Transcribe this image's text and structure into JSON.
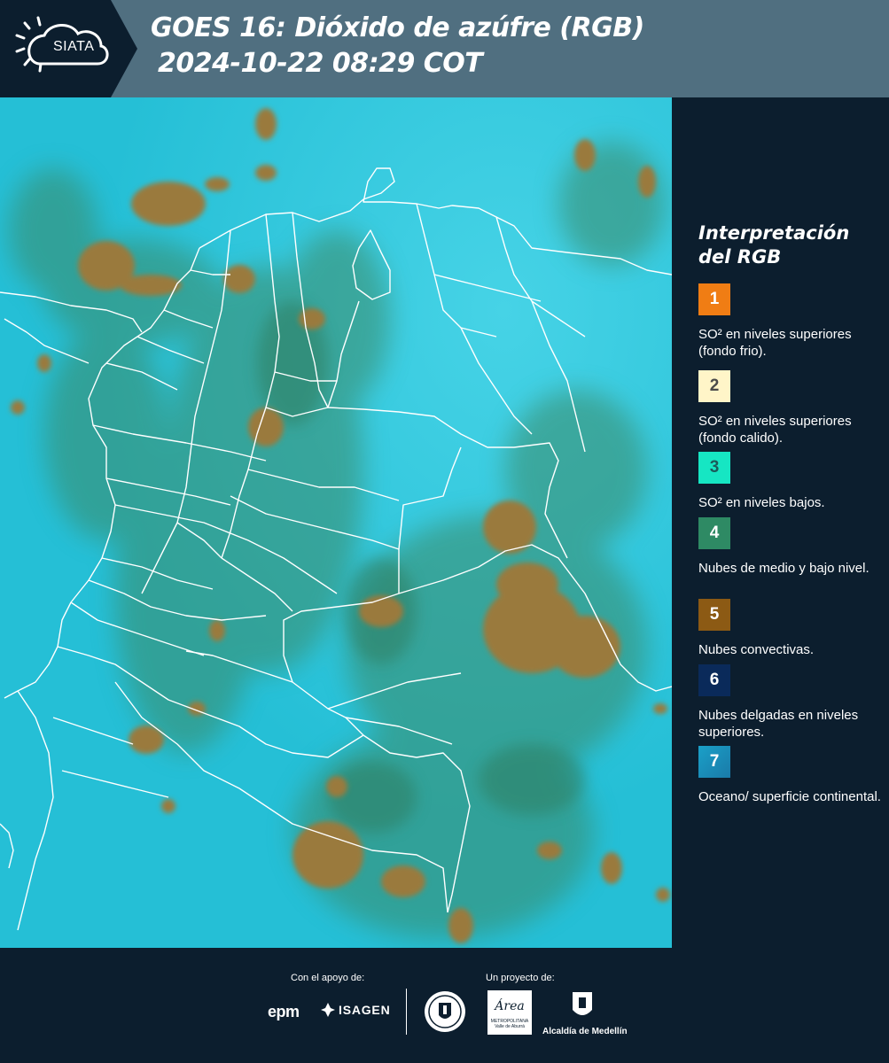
{
  "header": {
    "logo_text": "SIATA",
    "title_line1": "GOES 16: Dióxido de azúfre (RGB)",
    "title_line2": "2024-10-22 08:29 COT"
  },
  "legend": {
    "title": "Interpretación del RGB",
    "items": [
      {
        "number": "1",
        "color": "#f07d14",
        "number_color": "#ffffff",
        "label": "SO² en niveles superiores (fondo frio)."
      },
      {
        "number": "2",
        "color": "#fff5c8",
        "number_color": "#4a4a4a",
        "label": "SO² en niveles superiores (fondo calido)."
      },
      {
        "number": "3",
        "color": "#16e6c3",
        "number_color": "#1c5a5a",
        "label": "SO² en niveles bajos."
      },
      {
        "number": "4",
        "color": "#2e8a64",
        "number_color": "#ffffff",
        "label": "Nubes de medio y bajo nivel."
      },
      {
        "number": "5",
        "color": "#8c5a14",
        "number_color": "#ffffff",
        "label": "Nubes convectivas."
      },
      {
        "number": "6",
        "color": "#0a2a5a",
        "number_color": "#ffffff",
        "label": "Nubes delgadas en niveles superiores."
      },
      {
        "number": "7",
        "color": "#1aa0c8",
        "number_color": "#ffffff",
        "label": "Oceano/ superficie continental."
      }
    ]
  },
  "footer": {
    "support_caption": "Con el apoyo de:",
    "project_caption": "Un proyecto de:",
    "support_logos": [
      "epm",
      "ISAGEN"
    ],
    "project_logos": {
      "area_name": "Área",
      "area_sub1": "METROPOLITANA",
      "area_sub2": "Valle de Aburrá",
      "alcaldia": "Alcaldía de Medellín"
    }
  },
  "map": {
    "background_color": "#2cc6da",
    "convective_color": "#9b7a3a",
    "mid_cloud_color": "#3a8a6a",
    "border_color": "#ffffff"
  }
}
